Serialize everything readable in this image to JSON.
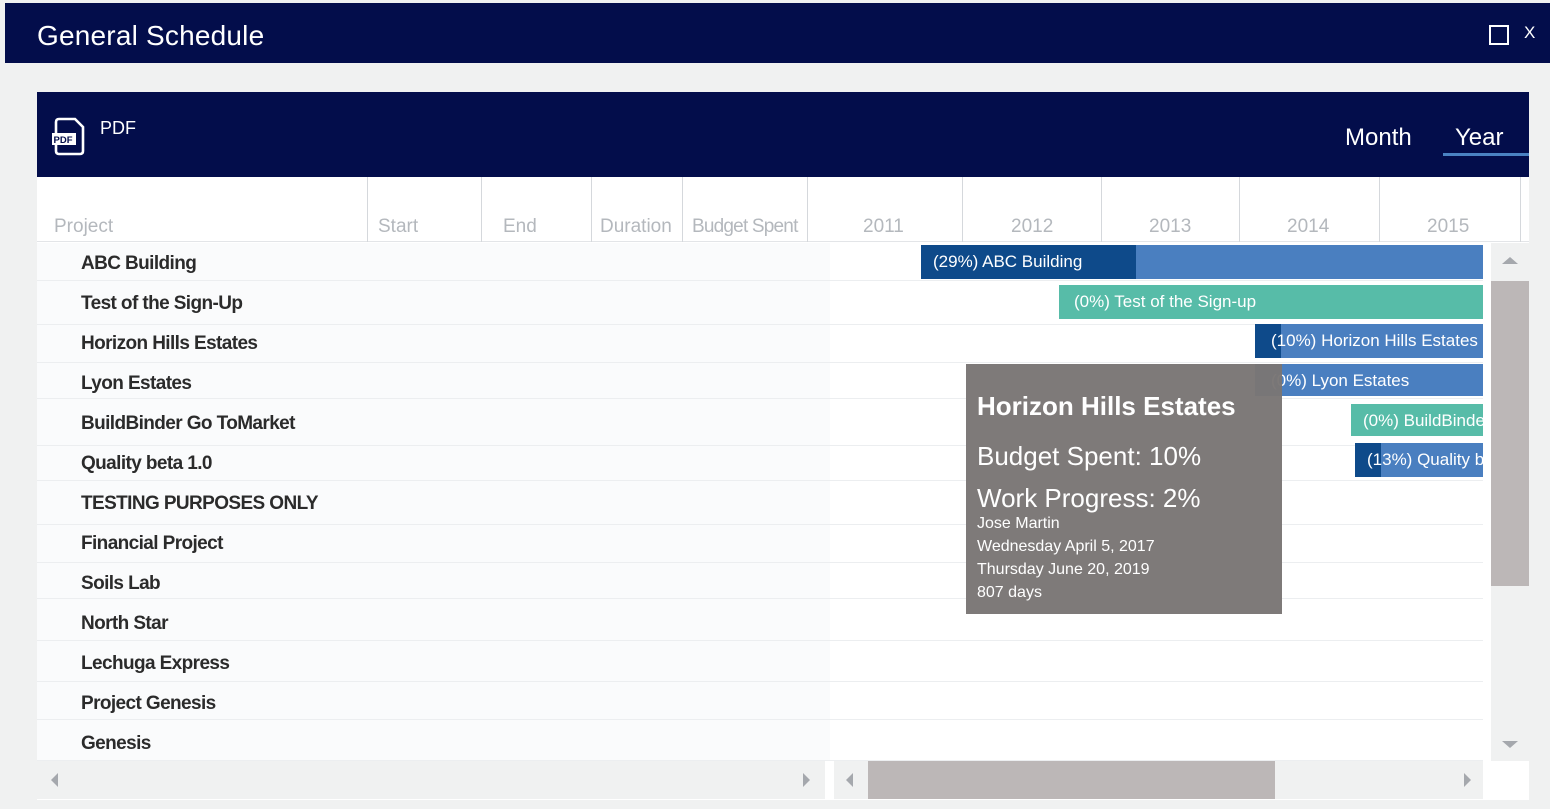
{
  "window": {
    "title": "General Schedule",
    "close_label": "X"
  },
  "toolbar": {
    "pdf_label": "PDF",
    "views": [
      "Month",
      "Year"
    ],
    "active_view": "Year"
  },
  "columns": [
    "Project",
    "Start",
    "End",
    "Duration",
    "Budget Spent"
  ],
  "years": [
    "2011",
    "2012",
    "2013",
    "2014",
    "2015"
  ],
  "projects": [
    "ABC Building",
    "Test of the Sign-Up",
    "Horizon Hills Estates",
    "Lyon Estates",
    "BuildBinder Go ToMarket",
    "Quality beta 1.0",
    "TESTING PURPOSES ONLY",
    "Financial Project",
    "Soils Lab",
    "North Star",
    "Lechuga Express",
    "Project Genesis",
    "Genesis"
  ],
  "bars": [
    {
      "label": "(29%) ABC Building",
      "progress": 0.29,
      "color": "#4a7fc0",
      "progress_color": "#0e4a8a"
    },
    {
      "label": "(0%) Test of the Sign-up",
      "progress": 0.0,
      "color": "#57bca8",
      "progress_color": "#2f9d88"
    },
    {
      "label": "(10%) Horizon Hills Estates",
      "progress": 0.1,
      "color": "#4a7fc0",
      "progress_color": "#0e4a8a"
    },
    {
      "label": "(0%) Lyon Estates",
      "progress": 0.0,
      "color": "#4a7fc0",
      "progress_color": "#0e4a8a"
    },
    {
      "label": "(0%) BuildBinde",
      "progress": 0.0,
      "color": "#57bca8",
      "progress_color": "#2f9d88"
    },
    {
      "label": "(13%) Quality b",
      "progress": 0.13,
      "color": "#4a7fc0",
      "progress_color": "#0e4a8a"
    },
    {
      "label": "",
      "progress": 0.0,
      "color": "#57bca8",
      "progress_color": "#2f9d88"
    }
  ],
  "tooltip": {
    "title": "Horizon Hills Estates",
    "budget": "Budget Spent: 10%",
    "work": "Work Progress: 2%",
    "manager": "Jose Martin",
    "start": "Wednesday April 5, 2017",
    "end": "Thursday June 20, 2019",
    "duration": "807 days"
  },
  "scroll": {
    "vertical_position": 0.0,
    "horizontal_position": 0.1
  }
}
